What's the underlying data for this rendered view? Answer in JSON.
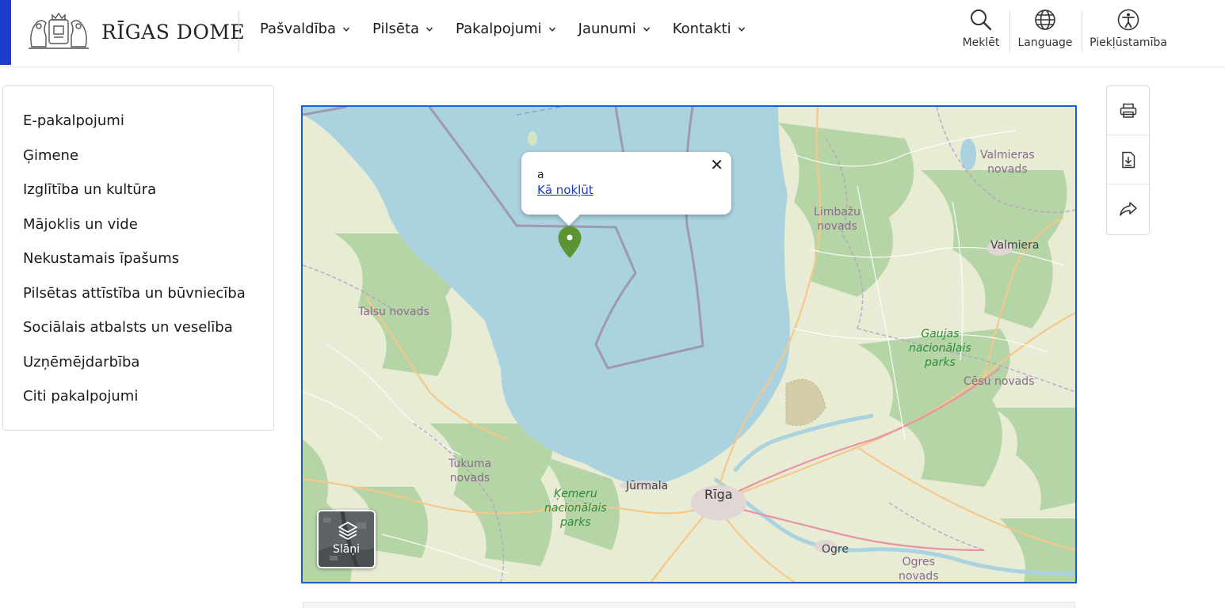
{
  "header": {
    "logo_text": "RĪGAS DOME",
    "nav": [
      {
        "label": "Pašvaldība"
      },
      {
        "label": "Pilsēta"
      },
      {
        "label": "Pakalpojumi"
      },
      {
        "label": "Jaunumi"
      },
      {
        "label": "Kontakti"
      }
    ],
    "utilities": {
      "search": "Meklēt",
      "language": "Language",
      "accessibility": "Piekļūstamība"
    }
  },
  "sidebar": {
    "items": [
      {
        "label": "E-pakalpojumi"
      },
      {
        "label": "Ģimene"
      },
      {
        "label": "Izglītība un kultūra"
      },
      {
        "label": "Mājoklis un vide"
      },
      {
        "label": "Nekustamais īpašums"
      },
      {
        "label": "Pilsētas attīstība un būvniecība"
      },
      {
        "label": "Sociālais atbalsts un veselība"
      },
      {
        "label": "Uzņēmējdarbība"
      },
      {
        "label": "Citi pakalpojumi"
      }
    ]
  },
  "map": {
    "popup": {
      "title": "a",
      "link": "Kā nokļūt",
      "close": "✕"
    },
    "layers_label": "Slāņi",
    "labels": {
      "valmieras": "Valmieras\nnovads",
      "limbazu": "Limbažu\nnovads",
      "valmiera": "Valmiera",
      "talsu": "Talsu novads",
      "gaujas": "Gaujas\nnacionālais\nparks",
      "cesu": "Cēsu novads",
      "tukuma": "Tukuma\nnovads",
      "kemeru": "Ķemeru\nnacionālais\nparks",
      "jurmala": "Jūrmala",
      "riga": "Rīga",
      "ogre": "Ogre",
      "ogres": "Ogres\nnovads"
    },
    "colors": {
      "sea": "#aad3df",
      "land": "#e8ecd5",
      "forest": "#add19e",
      "pin": "#5c9333",
      "border": "#1a5fc4"
    }
  },
  "tools": {
    "icons": [
      "printer-icon",
      "download-document-icon",
      "share-icon"
    ]
  }
}
